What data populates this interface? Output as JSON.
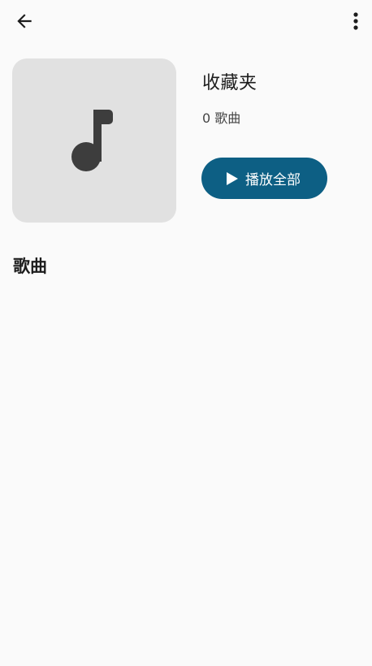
{
  "header": {
    "back_icon": "arrow-left-icon",
    "menu_icon": "more-vert-icon"
  },
  "playlist": {
    "cover_icon": "music-note-icon",
    "title": "收藏夹",
    "song_count": "0 歌曲",
    "play_all_label": "播放全部",
    "play_all_icon": "play-icon"
  },
  "songs_section": {
    "title": "歌曲",
    "items": []
  },
  "colors": {
    "background": "#fafafa",
    "cover_bg": "#e1e1e1",
    "accent": "#0d5f84",
    "icon": "#3d3d3d"
  }
}
